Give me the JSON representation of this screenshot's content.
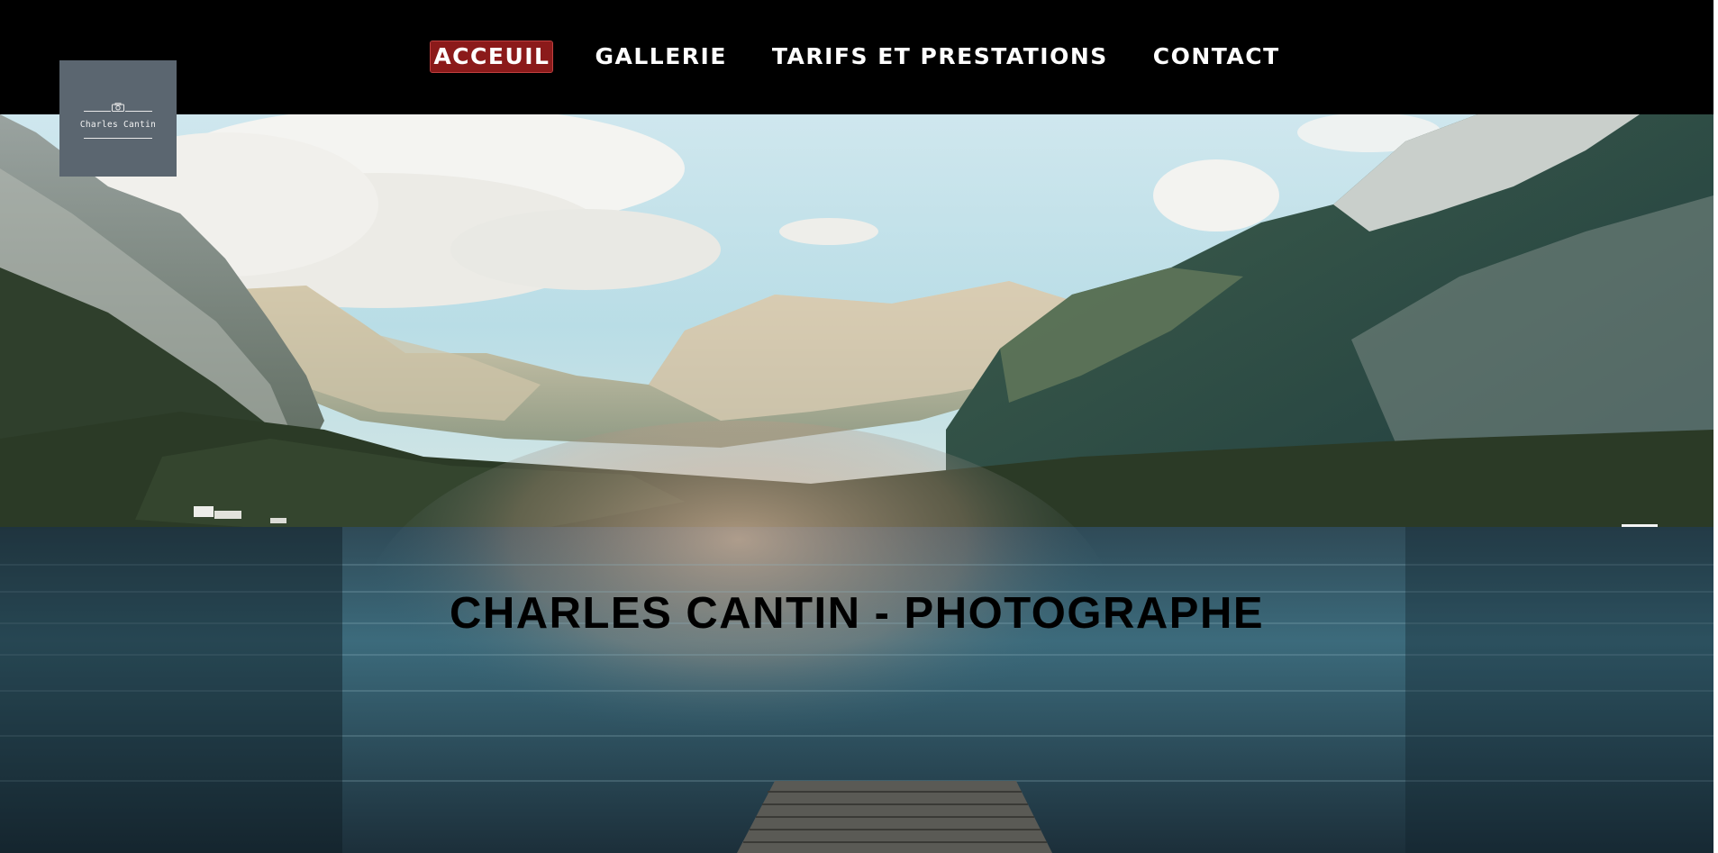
{
  "nav": {
    "items": [
      {
        "label": "ACCEUIL",
        "active": true
      },
      {
        "label": "GALLERIE",
        "active": false
      },
      {
        "label": "TARIFS ET PRESTATIONS",
        "active": false
      },
      {
        "label": "CONTACT",
        "active": false
      }
    ]
  },
  "logo": {
    "text": "Charles Cantin",
    "icon": "camera-icon"
  },
  "hero": {
    "title": "CHARLES CANTIN - PHOTOGRAPHE"
  },
  "colors": {
    "navbar_bg": "#000000",
    "active_nav_bg": "#8b1a1a",
    "logo_bg": "#5b6670",
    "title_color": "#000000"
  }
}
